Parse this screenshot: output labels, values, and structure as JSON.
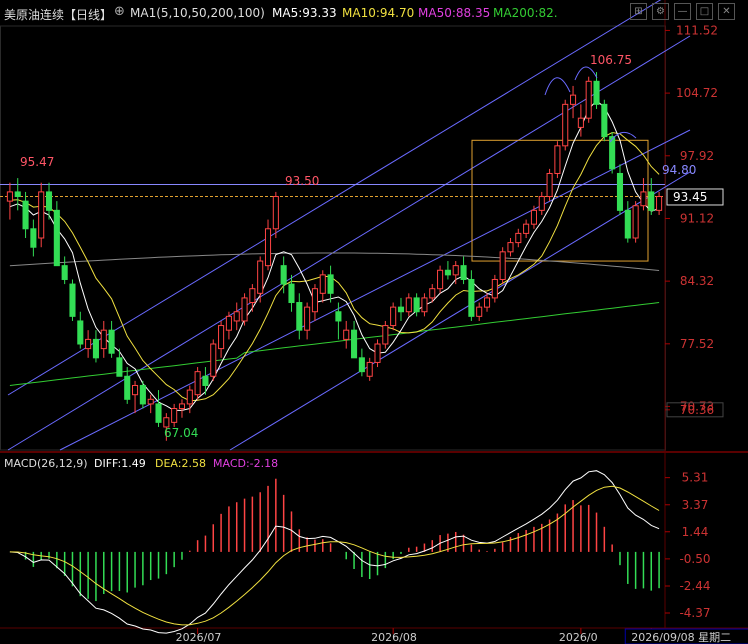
{
  "header": {
    "title": "美原油连续",
    "period": "【日线】",
    "ma_label": "MA1(5,10,50,200,100)",
    "ma5": "MA5:93.33",
    "ma10": "MA10:94.70",
    "ma50": "MA50:88.35",
    "ma200": "MA200:82.",
    "toolbar": [
      "⊞",
      "⚙",
      "—",
      "□",
      "✕"
    ]
  },
  "colors": {
    "bull": "#ff4444",
    "bear": "#33dd55",
    "ma5": "#ffffff",
    "ma10": "#f0e040",
    "ma50": "#e040e0",
    "ma200": "#33cc33",
    "ma100": "#888888",
    "channel": "#6a6aff"
  },
  "macd_header": {
    "label": "MACD(26,12,9)",
    "diff": "DIFF:1.49",
    "dea": "DEA:2.58",
    "macd": "MACD:-2.18"
  },
  "annotations": {
    "high": "106.75",
    "low": "67.04",
    "left_high": "95.47",
    "mid_high": "93.50",
    "hline": "94.80"
  },
  "price_tag": "93.45",
  "chart_data": {
    "type": "candlestick",
    "price_axis": [
      "111.52",
      "104.72",
      "97.92",
      "91.12",
      "84.32",
      "77.52",
      "70.73",
      "70.36"
    ],
    "ylim": [
      66,
      112
    ],
    "macd_axis": [
      "5.31",
      "3.37",
      "1.44",
      "-0.50",
      "-2.44",
      "-4.37"
    ],
    "macd_ylim": [
      -5.3,
      6.0
    ],
    "date_labels": [
      "2026/07",
      "2026/08",
      "2026/0",
      "2026/09/08 星期二"
    ],
    "date_label_index": [
      24,
      49,
      73,
      82
    ],
    "candles": [
      [
        93,
        95,
        91,
        94
      ],
      [
        94,
        95.5,
        92,
        93.5
      ],
      [
        93,
        94,
        89,
        90
      ],
      [
        90,
        91,
        87,
        88
      ],
      [
        89,
        95,
        88,
        94
      ],
      [
        94,
        95,
        91,
        92
      ],
      [
        92,
        93,
        86,
        86
      ],
      [
        86,
        87,
        84,
        84.5
      ],
      [
        84,
        84.5,
        80,
        80.5
      ],
      [
        80,
        81,
        77,
        77.5
      ],
      [
        77,
        79,
        76,
        78
      ],
      [
        78,
        79,
        75.5,
        76
      ],
      [
        77,
        80,
        76,
        79
      ],
      [
        79,
        80,
        76,
        76.5
      ],
      [
        76,
        77,
        74,
        74
      ],
      [
        74,
        75,
        71,
        71.5
      ],
      [
        72,
        73.5,
        70,
        73
      ],
      [
        73,
        73.5,
        70.5,
        71
      ],
      [
        71,
        72,
        70,
        71.5
      ],
      [
        71,
        72.5,
        68.5,
        69
      ],
      [
        68.5,
        70,
        67,
        69.5
      ],
      [
        69,
        71,
        68.5,
        70.5
      ],
      [
        70.5,
        71.5,
        69.5,
        71
      ],
      [
        71,
        73,
        70,
        72.5
      ],
      [
        72,
        75,
        71.5,
        74.5
      ],
      [
        74,
        75,
        72,
        73
      ],
      [
        74,
        78,
        73.5,
        77.5
      ],
      [
        77,
        80,
        76,
        79.5
      ],
      [
        79,
        81,
        78,
        80.5
      ],
      [
        80,
        82,
        79,
        81
      ],
      [
        80,
        83,
        79.5,
        82.5
      ],
      [
        82,
        84,
        81,
        83.5
      ],
      [
        83,
        87,
        82,
        86.5
      ],
      [
        86,
        91,
        85.5,
        90
      ],
      [
        90,
        94,
        89,
        93.5
      ],
      [
        86,
        87,
        83,
        84
      ],
      [
        84,
        85,
        81,
        82
      ],
      [
        82,
        83,
        78,
        79
      ],
      [
        79,
        82,
        78,
        81.5
      ],
      [
        81,
        84,
        80,
        83.5
      ],
      [
        83,
        85.5,
        82,
        85
      ],
      [
        85,
        86,
        82,
        83
      ],
      [
        81,
        82,
        78,
        80
      ],
      [
        78,
        80,
        77,
        79
      ],
      [
        79,
        80,
        76,
        76
      ],
      [
        76,
        77,
        74,
        74.5
      ],
      [
        74,
        76,
        73.5,
        75.5
      ],
      [
        75.5,
        78,
        75,
        77.5
      ],
      [
        77.5,
        80,
        77,
        79.5
      ],
      [
        79.5,
        82,
        79,
        81.5
      ],
      [
        81.5,
        82.5,
        80,
        81
      ],
      [
        81,
        83,
        80.5,
        82.5
      ],
      [
        82.5,
        83,
        80.5,
        81
      ],
      [
        81,
        83,
        80.5,
        82.5
      ],
      [
        82.5,
        84,
        82,
        83.5
      ],
      [
        83.5,
        86,
        83,
        85.5
      ],
      [
        85.5,
        86.5,
        84.5,
        85
      ],
      [
        85,
        86.5,
        84,
        86
      ],
      [
        86,
        87,
        84,
        84.5
      ],
      [
        84.5,
        85.5,
        80,
        80.5
      ],
      [
        80.5,
        82,
        80,
        81.5
      ],
      [
        81.5,
        83,
        81,
        82.5
      ],
      [
        82.5,
        85,
        82,
        84.5
      ],
      [
        84.5,
        88,
        84,
        87.5
      ],
      [
        87.5,
        89,
        87,
        88.5
      ],
      [
        88.5,
        90,
        88,
        89.5
      ],
      [
        89.5,
        91,
        89,
        90.5
      ],
      [
        90.5,
        92.5,
        90,
        92
      ],
      [
        92,
        94,
        91.5,
        93.5
      ],
      [
        93.5,
        96.5,
        93,
        96
      ],
      [
        96,
        99.5,
        95.5,
        99
      ],
      [
        99,
        104,
        98.5,
        103.5
      ],
      [
        103.5,
        105.5,
        102,
        104.5
      ],
      [
        101,
        103.5,
        100,
        102
      ],
      [
        102,
        106.5,
        101.5,
        106
      ],
      [
        106,
        107,
        103,
        103.5
      ],
      [
        103.5,
        104,
        99.5,
        100
      ],
      [
        100,
        100.5,
        96,
        96.5
      ],
      [
        96,
        97,
        91.5,
        92
      ],
      [
        92,
        93,
        88.5,
        89
      ],
      [
        89,
        93,
        88.5,
        92.5
      ],
      [
        92.5,
        95.5,
        92,
        94
      ],
      [
        94,
        95.5,
        91.5,
        92
      ],
      [
        92,
        94,
        91.5,
        93.5
      ]
    ]
  }
}
